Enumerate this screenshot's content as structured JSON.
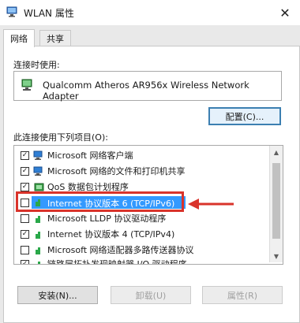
{
  "window": {
    "title": "WLAN 属性",
    "close_symbol": "✕"
  },
  "tabs": [
    {
      "label": "网络"
    },
    {
      "label": "共享"
    }
  ],
  "connect_using": {
    "label": "连接时使用:",
    "adapter_name": "Qualcomm Atheros AR956x Wireless Network Adapter",
    "configure_label": "配置(C)..."
  },
  "items_section": {
    "label": "此连接使用下列项目(O):",
    "items": [
      {
        "label": "Microsoft 网络客户端",
        "checked": true,
        "icon": "network-client-icon"
      },
      {
        "label": "Microsoft 网络的文件和打印机共享",
        "checked": true,
        "icon": "network-share-icon"
      },
      {
        "label": "QoS 数据包计划程序",
        "checked": true,
        "icon": "qos-icon"
      },
      {
        "label": "Internet 协议版本 6 (TCP/IPv6)",
        "checked": false,
        "selected": true,
        "icon": "protocol-icon"
      },
      {
        "label": "Microsoft LLDP 协议驱动程序",
        "checked": false,
        "icon": "protocol-icon"
      },
      {
        "label": "Internet 协议版本 4 (TCP/IPv4)",
        "checked": true,
        "icon": "protocol-icon"
      },
      {
        "label": "Microsoft 网络适配器多路传送器协议",
        "checked": false,
        "icon": "protocol-icon"
      },
      {
        "label": "链路层拓扑发现映射器 I/O 驱动程序",
        "checked": true,
        "icon": "protocol-icon"
      }
    ]
  },
  "buttons": {
    "install": "安装(N)...",
    "uninstall": "卸载(U)",
    "properties": "属性(R)"
  },
  "colors": {
    "selection": "#3399ff",
    "highlight": "#d9332b"
  }
}
